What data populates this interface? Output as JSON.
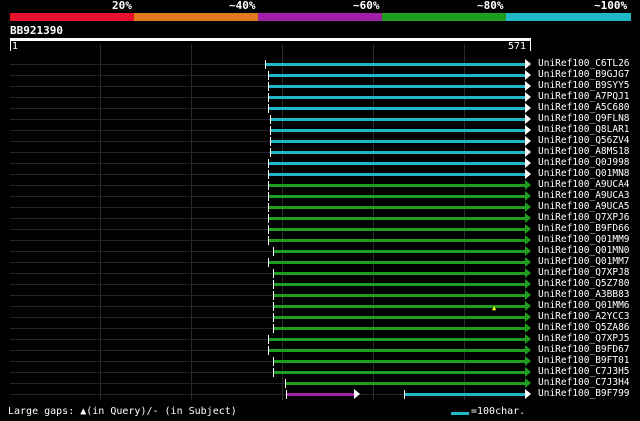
{
  "color_scale": {
    "segments": [
      {
        "label": "20%",
        "color": "#e8102a"
      },
      {
        "label": "~40%",
        "color": "#e07a1a"
      },
      {
        "label": "~60%",
        "color": "#a01fa6"
      },
      {
        "label": "~80%",
        "color": "#1e9d1e"
      },
      {
        "label": "~100%",
        "color": "#1fb8c9"
      }
    ]
  },
  "query": {
    "id": "BB921390",
    "start": "1",
    "end": "571"
  },
  "hits": [
    {
      "name": "UniRef100_C6TL26",
      "color": "#1fb8c9"
    },
    {
      "name": "UniRef100_B9GJG7",
      "color": "#1fb8c9"
    },
    {
      "name": "UniRef100_B9SYY5",
      "color": "#1fb8c9"
    },
    {
      "name": "UniRef100_A7PQJ1",
      "color": "#1fb8c9"
    },
    {
      "name": "UniRef100_A5C680",
      "color": "#1fb8c9"
    },
    {
      "name": "UniRef100_Q9FLN8",
      "color": "#1fb8c9"
    },
    {
      "name": "UniRef100_Q8LAR1",
      "color": "#1fb8c9"
    },
    {
      "name": "UniRef100_Q56ZV4",
      "color": "#1fb8c9"
    },
    {
      "name": "UniRef100_A8MS18",
      "color": "#1fb8c9"
    },
    {
      "name": "UniRef100_Q0J998",
      "color": "#1fb8c9"
    },
    {
      "name": "UniRef100_Q01MN8",
      "color": "#1fb8c9"
    },
    {
      "name": "UniRef100_A9UCA4",
      "color": "#1e9d1e"
    },
    {
      "name": "UniRef100_A9UCA3",
      "color": "#1e9d1e"
    },
    {
      "name": "UniRef100_A9UCA5",
      "color": "#1e9d1e"
    },
    {
      "name": "UniRef100_Q7XPJ6",
      "color": "#1e9d1e"
    },
    {
      "name": "UniRef100_B9FD66",
      "color": "#1e9d1e"
    },
    {
      "name": "UniRef100_Q01MM9",
      "color": "#1e9d1e"
    },
    {
      "name": "UniRef100_Q01MN0",
      "color": "#1e9d1e"
    },
    {
      "name": "UniRef100_Q01MM7",
      "color": "#1e9d1e"
    },
    {
      "name": "UniRef100_Q7XPJ8",
      "color": "#1e9d1e"
    },
    {
      "name": "UniRef100_Q5Z780",
      "color": "#1e9d1e"
    },
    {
      "name": "UniRef100_A3BB83",
      "color": "#1e9d1e"
    },
    {
      "name": "UniRef100_Q01MM6",
      "color": "#1e9d1e"
    },
    {
      "name": "UniRef100_A2YCC3",
      "color": "#1e9d1e"
    },
    {
      "name": "UniRef100_Q5ZA86",
      "color": "#1e9d1e"
    },
    {
      "name": "UniRef100_Q7XPJ5",
      "color": "#1e9d1e"
    },
    {
      "name": "UniRef100_B9FD67",
      "color": "#1e9d1e"
    },
    {
      "name": "UniRef100_B9FT01",
      "color": "#1e9d1e"
    },
    {
      "name": "UniRef100_C7J3H5",
      "color": "#1e9d1e"
    },
    {
      "name": "UniRef100_C7J3H4",
      "color": "#1e9d1e"
    },
    {
      "name": "UniRef100_B9F799",
      "color": "#1fb8c9"
    }
  ],
  "footer": {
    "gaps_label": "Large gaps: ▲(in Query)/- (in Subject)",
    "legend_label": "=100char."
  }
}
